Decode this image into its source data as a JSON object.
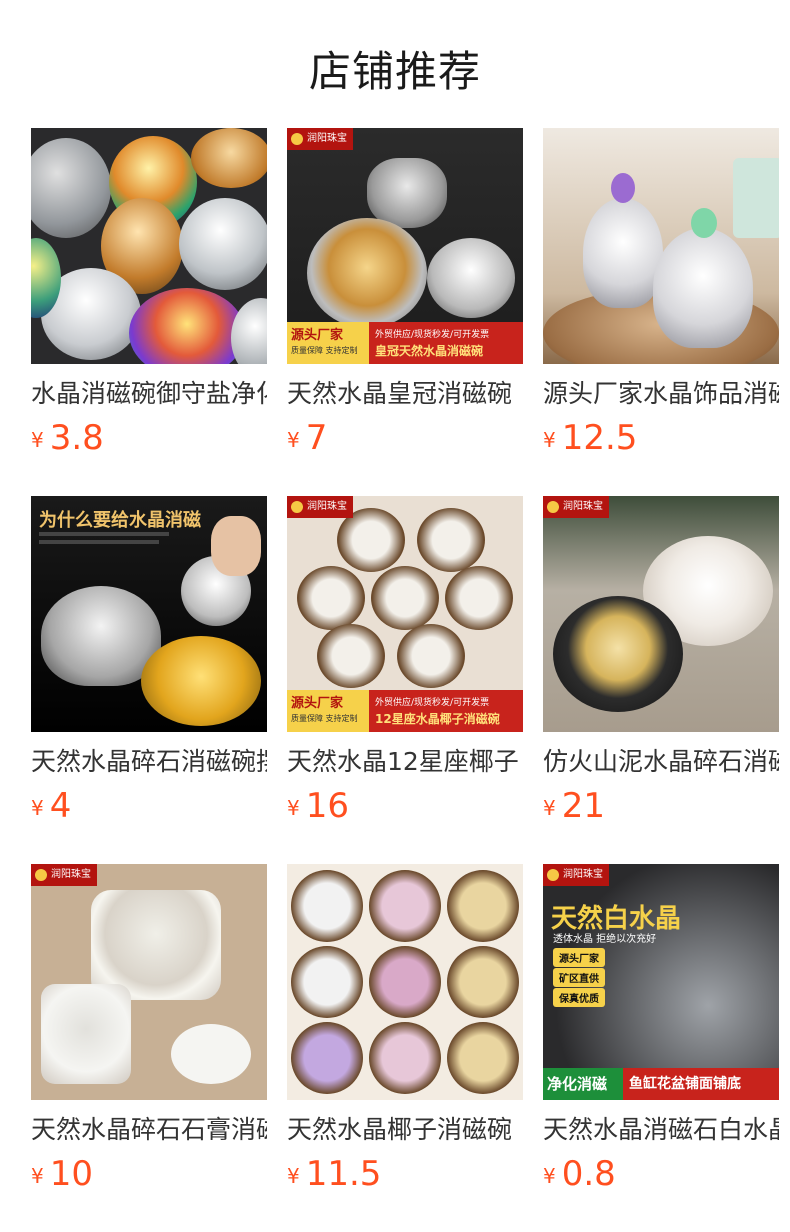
{
  "page": {
    "title": "店铺推荐"
  },
  "brand_label": "润阳珠宝",
  "products": [
    {
      "name": "水晶消磁碗御守盐净化",
      "price": "3.8",
      "image": "crystal-candy-jars"
    },
    {
      "name": "天然水晶皇冠消磁碗",
      "price": "7",
      "image": "crown-crystal-bowl",
      "banner": {
        "left_title": "源头厂家",
        "left_sub": "质量保障 支持定制",
        "right_small": "外贸供应/现货秒发/可开发票",
        "right_big": "皇冠天然水晶消磁碗"
      }
    },
    {
      "name": "源头厂家水晶饰品消磁",
      "price": "12.5",
      "image": "crystal-dome-jars"
    },
    {
      "name": "天然水晶碎石消磁碗摆件",
      "price": "4",
      "image": "why-degauss",
      "overlay": {
        "headline": "为什么要给水晶消磁"
      }
    },
    {
      "name": "天然水晶12星座椰子",
      "price": "16",
      "image": "zodiac-coconut-bowls",
      "banner": {
        "left_title": "源头厂家",
        "left_sub": "质量保障 支持定制",
        "right_small": "外贸供应/现货秒发/可开发票",
        "right_big": "12星座水晶椰子消磁碗"
      }
    },
    {
      "name": "仿火山泥水晶碎石消磁",
      "price": "21",
      "image": "volcanic-clay-bowls"
    },
    {
      "name": "天然水晶碎石石膏消磁",
      "price": "10",
      "image": "terrazzo-bowls"
    },
    {
      "name": "天然水晶椰子消磁碗",
      "price": "11.5",
      "image": "coconut-grid"
    },
    {
      "name": "天然水晶消磁石白水晶",
      "price": "0.8",
      "image": "white-crystal-chips",
      "overlay": {
        "headline": "天然白水晶",
        "sub": "透体水晶 拒绝以次充好",
        "chips": [
          "源头厂家",
          "矿区直供",
          "保真优质"
        ],
        "bottom_left": "净化消磁",
        "bottom_right": "鱼缸花盆铺面铺底"
      }
    }
  ],
  "currency_symbol": "¥",
  "colors": {
    "price": "#ff4f1f",
    "brand_red": "#b3140f",
    "banner_yellow": "#f6d14a"
  }
}
